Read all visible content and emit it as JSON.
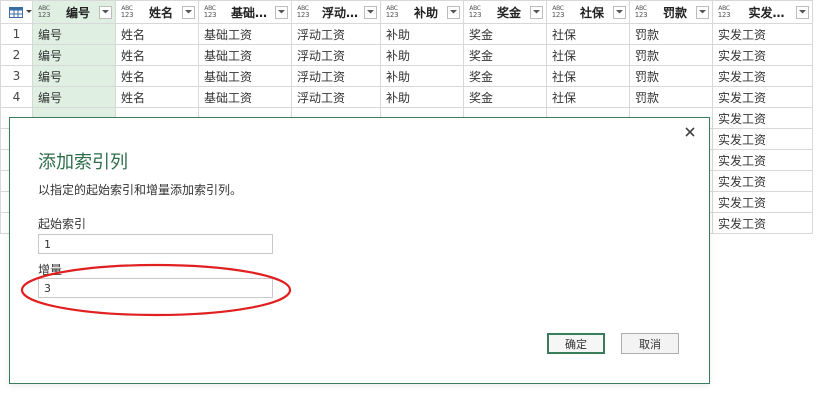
{
  "table": {
    "columns": [
      {
        "name": "编号",
        "type": "ABC\n123"
      },
      {
        "name": "姓名",
        "type": "ABC\n123"
      },
      {
        "name": "基础…",
        "type": "ABC\n123"
      },
      {
        "name": "浮动…",
        "type": "ABC\n123"
      },
      {
        "name": "补助",
        "type": "ABC\n123"
      },
      {
        "name": "奖金",
        "type": "ABC\n123"
      },
      {
        "name": "社保",
        "type": "ABC\n123"
      },
      {
        "name": "罚款",
        "type": "ABC\n123"
      },
      {
        "name": "实发…",
        "type": "ABC\n123"
      }
    ],
    "type_top": "ABC",
    "type_bottom": "123",
    "rows": [
      {
        "n": "1",
        "cells": [
          "编号",
          "姓名",
          "基础工资",
          "浮动工资",
          "补助",
          "奖金",
          "社保",
          "罚款",
          "实发工资"
        ]
      },
      {
        "n": "2",
        "cells": [
          "编号",
          "姓名",
          "基础工资",
          "浮动工资",
          "补助",
          "奖金",
          "社保",
          "罚款",
          "实发工资"
        ]
      },
      {
        "n": "3",
        "cells": [
          "编号",
          "姓名",
          "基础工资",
          "浮动工资",
          "补助",
          "奖金",
          "社保",
          "罚款",
          "实发工资"
        ]
      },
      {
        "n": "4",
        "cells": [
          "编号",
          "姓名",
          "基础工资",
          "浮动工资",
          "补助",
          "奖金",
          "社保",
          "罚款",
          "实发工资"
        ]
      },
      {
        "n": "",
        "cells": [
          "",
          "",
          "",
          "",
          "",
          "",
          "",
          "",
          "实发工资"
        ]
      },
      {
        "n": "",
        "cells": [
          "",
          "",
          "",
          "",
          "",
          "",
          "",
          "",
          "实发工资"
        ]
      },
      {
        "n": "",
        "cells": [
          "",
          "",
          "",
          "",
          "",
          "",
          "",
          "",
          "实发工资"
        ]
      },
      {
        "n": "",
        "cells": [
          "",
          "",
          "",
          "",
          "",
          "",
          "",
          "",
          "实发工资"
        ]
      },
      {
        "n": "",
        "cells": [
          "",
          "",
          "",
          "",
          "",
          "",
          "",
          "",
          "实发工资"
        ]
      },
      {
        "n": "",
        "cells": [
          "",
          "",
          "",
          "",
          "",
          "",
          "",
          "",
          "实发工资"
        ]
      }
    ]
  },
  "dialog": {
    "title": "添加索引列",
    "description": "以指定的起始索引和增量添加索引列。",
    "start_label": "起始索引",
    "start_value": "1",
    "step_label": "增量",
    "step_value": "3",
    "ok_label": "确定",
    "cancel_label": "取消"
  },
  "colors": {
    "accent": "#3a7d5a",
    "selected_col": "#dff0e3",
    "annotation": "#e02020"
  },
  "icons": {
    "corner": "table-icon",
    "filter": "chevron-down-icon",
    "close": "close-icon"
  }
}
